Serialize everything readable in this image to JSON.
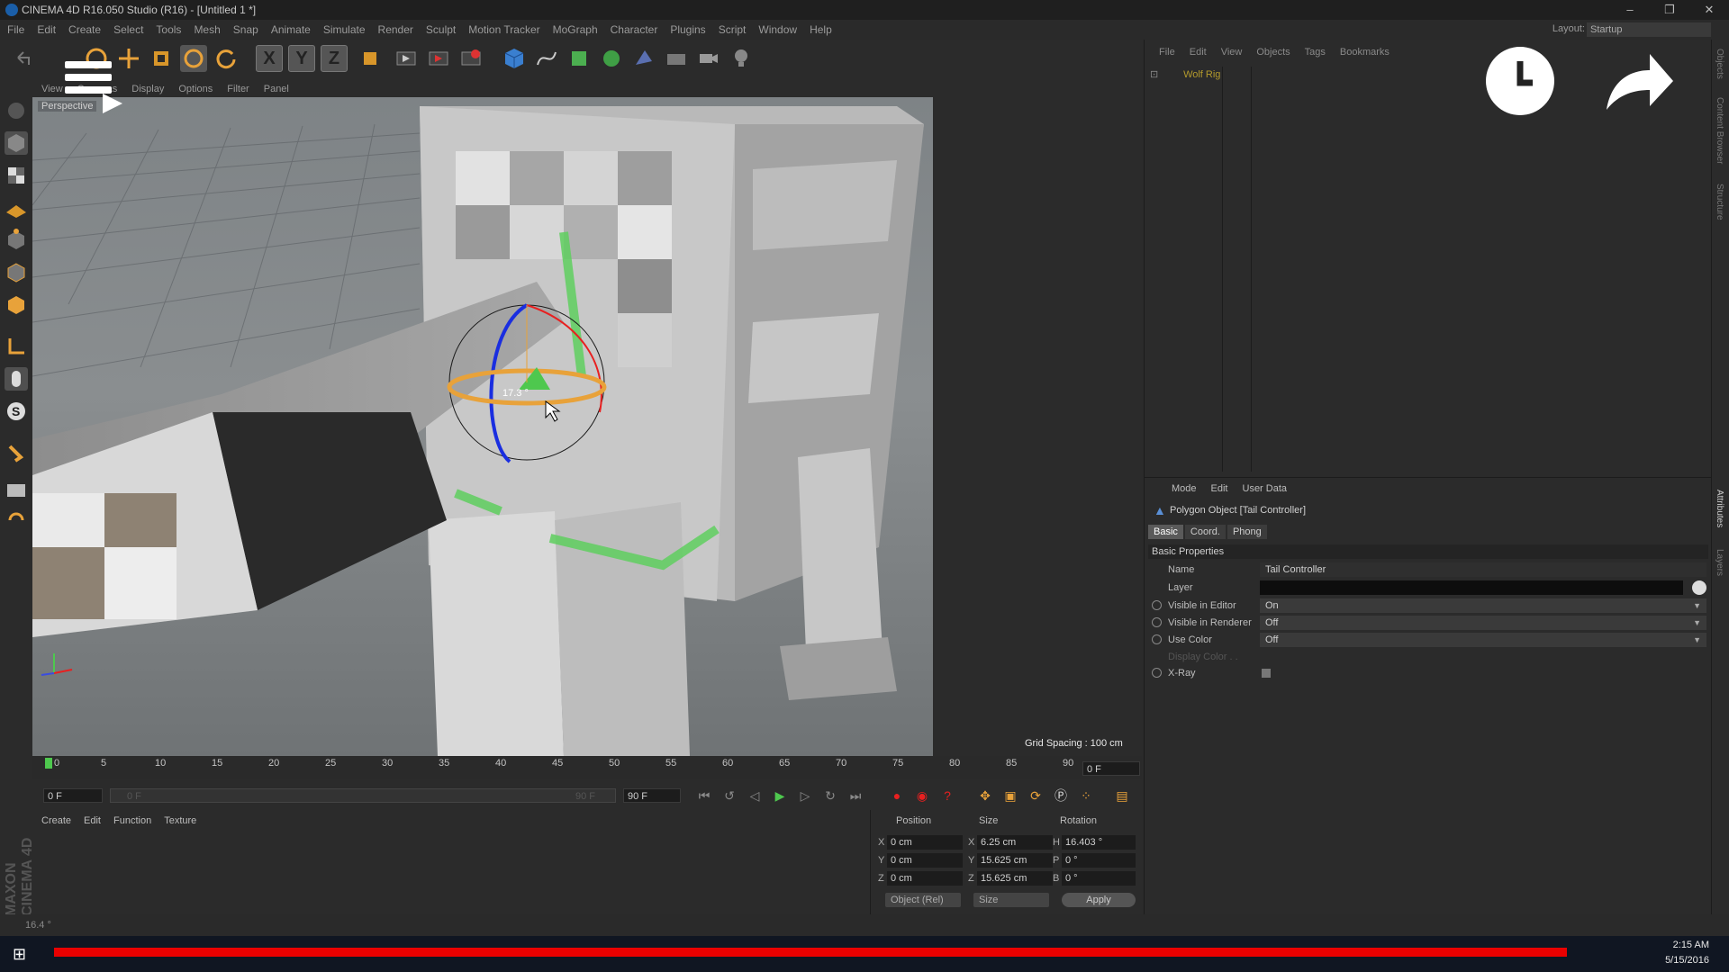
{
  "window": {
    "title": "CINEMA 4D R16.050 Studio (R16) - [Untitled 1 *]",
    "controls": [
      "–",
      "❐",
      "✕"
    ]
  },
  "menubar": {
    "items": [
      "File",
      "Edit",
      "Create",
      "Select",
      "Tools",
      "Mesh",
      "Snap",
      "Animate",
      "Simulate",
      "Render",
      "Sculpt",
      "Motion Tracker",
      "MoGraph",
      "Character",
      "Plugins",
      "Script",
      "Window",
      "Help"
    ],
    "layout_label": "Layout:",
    "layout_value": "Startup"
  },
  "toolbar": {
    "axis_x": "X",
    "axis_y": "Y",
    "axis_z": "Z"
  },
  "viewport": {
    "menu": [
      "View",
      "Cameras",
      "Display",
      "Options",
      "Filter",
      "Panel"
    ],
    "camera_label": "Perspective",
    "grid_spacing": "Grid Spacing : 100 cm",
    "rotation_readout": "17.3 °"
  },
  "timeline": {
    "ticks": [
      "0",
      "5",
      "10",
      "15",
      "20",
      "25",
      "30",
      "35",
      "40",
      "45",
      "50",
      "55",
      "60",
      "65",
      "70",
      "75",
      "80",
      "85",
      "90"
    ],
    "current_frame": "0 F",
    "start_frame": "0 F",
    "range_start": "0 F",
    "range_end": "90 F",
    "end_frame": "90 F"
  },
  "material_manager": {
    "menu": [
      "Create",
      "Edit",
      "Function",
      "Texture"
    ]
  },
  "coordinates": {
    "headers": [
      "Position",
      "Size",
      "Rotation"
    ],
    "rows": [
      {
        "axis": "X",
        "pos": "0 cm",
        "size_axis": "X",
        "size": "6.25 cm",
        "rot_axis": "H",
        "rot": "16.403 °"
      },
      {
        "axis": "Y",
        "pos": "0 cm",
        "size_axis": "Y",
        "size": "15.625 cm",
        "rot_axis": "P",
        "rot": "0 °"
      },
      {
        "axis": "Z",
        "pos": "0 cm",
        "size_axis": "Z",
        "size": "15.625 cm",
        "rot_axis": "B",
        "rot": "0 °"
      }
    ],
    "mode": "Object (Rel)",
    "size_mode": "Size",
    "apply": "Apply"
  },
  "object_manager": {
    "menu": [
      "File",
      "Edit",
      "View",
      "Objects",
      "Tags",
      "Bookmarks"
    ],
    "object": "Wolf Rig"
  },
  "attributes": {
    "menu": [
      "Mode",
      "Edit",
      "User Data"
    ],
    "object_title": "Polygon Object [Tail Controller]",
    "tabs": [
      "Basic",
      "Coord.",
      "Phong"
    ],
    "section": "Basic Properties",
    "name_label": "Name",
    "name_value": "Tail Controller",
    "layer_label": "Layer",
    "visible_editor_label": "Visible in Editor",
    "visible_editor_value": "On",
    "visible_renderer_label": "Visible in Renderer",
    "visible_renderer_value": "Off",
    "use_color_label": "Use Color",
    "use_color_value": "Off",
    "display_color_label": "Display Color . .",
    "xray_label": "X-Ray"
  },
  "side_tabs": [
    "Objects",
    "Content Browser",
    "Structure",
    "Attributes",
    "Layers"
  ],
  "status": {
    "text": "16.4 °"
  },
  "branding": {
    "logo": "MAXON CINEMA 4D"
  },
  "taskbar": {
    "time": "2:15 AM",
    "date": "5/15/2016"
  },
  "colors": {
    "red_progress": "#ea0000",
    "accent_orange": "#e8a23a",
    "highlight_green": "#5fcf5f"
  }
}
